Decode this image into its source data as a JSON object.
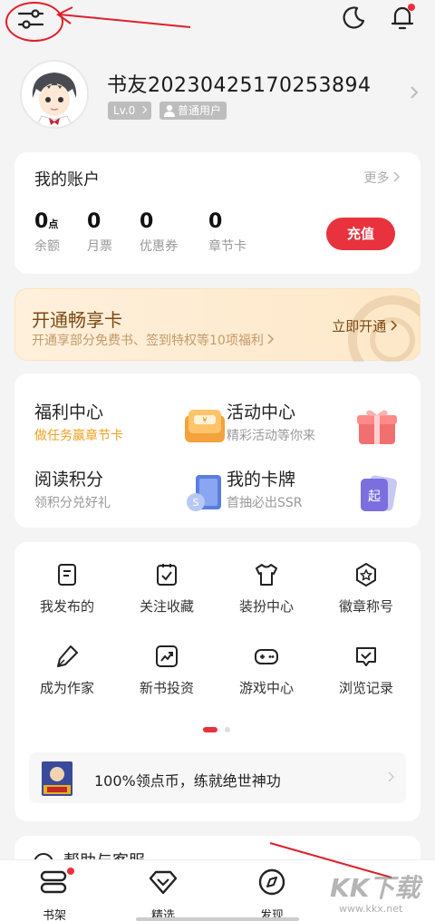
{
  "top_bar": {
    "settings_icon": "settings-sliders-icon",
    "moon_icon": "moon-icon",
    "bell_icon": "bell-icon",
    "accent": "#e0202a"
  },
  "profile": {
    "nickname": "书友20230425170253894",
    "level": "Lv.0",
    "user_type": "普通用户"
  },
  "account": {
    "title": "我的账户",
    "more": "更多",
    "stats": [
      {
        "value": "0",
        "unit": "点",
        "label": "余额"
      },
      {
        "value": "0",
        "unit": "",
        "label": "月票"
      },
      {
        "value": "0",
        "unit": "",
        "label": "优惠券"
      },
      {
        "value": "0",
        "unit": "",
        "label": "章节卡"
      }
    ],
    "recharge": "充值"
  },
  "vip": {
    "title": "开通畅享卡",
    "subtitle": "开通享部分免费书、签到特权等10项福利",
    "open": "立即开通"
  },
  "centers": [
    {
      "title": "福利中心",
      "subtitle": "做任务赢章节卡",
      "icon": "welfare-icon"
    },
    {
      "title": "活动中心",
      "subtitle": "精彩活动等你来",
      "icon": "gift-icon"
    },
    {
      "title": "阅读积分",
      "subtitle": "领积分兑好礼",
      "icon": "points-book-icon"
    },
    {
      "title": "我的卡牌",
      "subtitle": "首抽必出SSR",
      "icon": "card-icon"
    }
  ],
  "grid": [
    {
      "label": "我发布的",
      "icon": "published-icon"
    },
    {
      "label": "关注收藏",
      "icon": "favorites-icon"
    },
    {
      "label": "装扮中心",
      "icon": "outfit-icon"
    },
    {
      "label": "徽章称号",
      "icon": "badge-icon"
    },
    {
      "label": "成为作家",
      "icon": "pen-icon"
    },
    {
      "label": "新书投资",
      "icon": "investment-icon"
    },
    {
      "label": "游戏中心",
      "icon": "gamepad-icon"
    },
    {
      "label": "浏览记录",
      "icon": "history-icon"
    }
  ],
  "promo": {
    "text": "100%领点币，练就绝世神功"
  },
  "help": {
    "text": "帮助与客服"
  },
  "bottom_nav": [
    {
      "label": "书架",
      "icon": "bookshelf-icon"
    },
    {
      "label": "精选",
      "icon": "diamond-icon"
    },
    {
      "label": "发现",
      "icon": "compass-icon"
    }
  ],
  "watermark": {
    "big": "KK下载",
    "small": "www.kkx.net"
  }
}
